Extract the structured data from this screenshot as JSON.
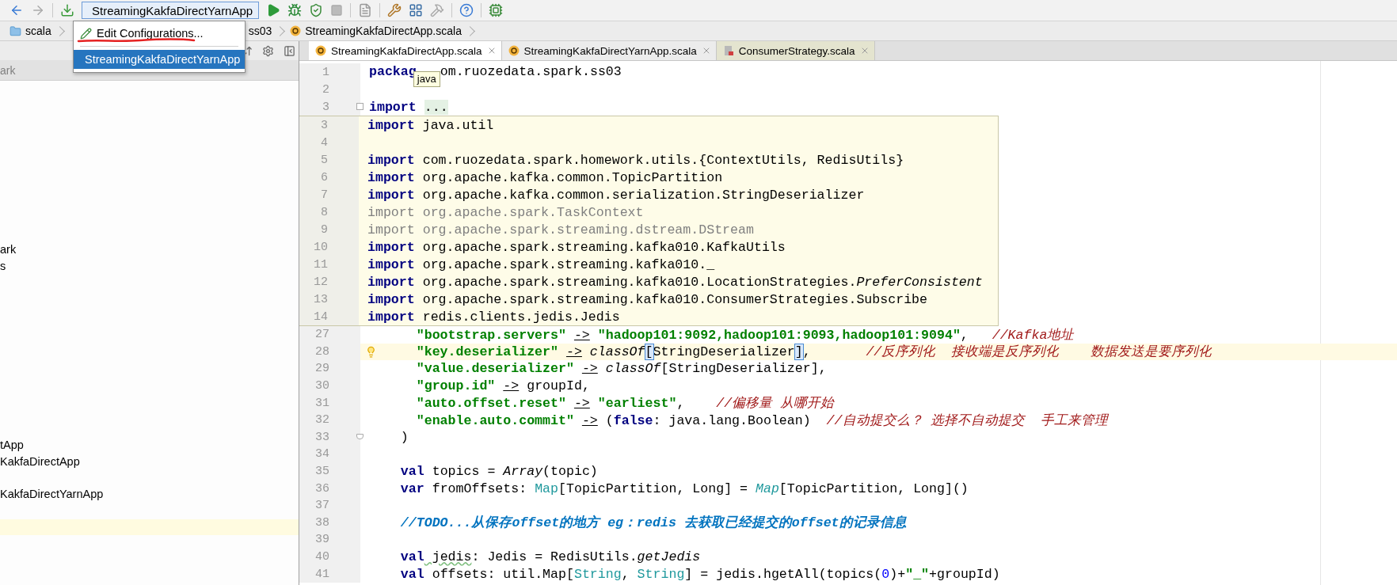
{
  "toolbar": {
    "run_config": "StreamingKakfaDirectYarnApp"
  },
  "run_menu": {
    "items": [
      {
        "kind": "edit",
        "label": "Edit Configurations...",
        "selected": false
      },
      {
        "kind": "config",
        "label": "StreamingKakfaDirectYarnApp",
        "selected": true
      }
    ]
  },
  "breadcrumbs": [
    {
      "kind": "folder",
      "label": "scala"
    },
    {
      "kind": "package",
      "label": "ss03"
    },
    {
      "kind": "object",
      "label": "StreamingKakfaDirectApp.scala"
    }
  ],
  "project_panel": {
    "header": "ark",
    "items": [
      {
        "label": "ark"
      },
      {
        "label": "s"
      },
      {
        "label": "tApp"
      },
      {
        "label": "KakfaDirectApp"
      },
      {
        "label": "KakfaDirectYarnApp"
      }
    ]
  },
  "tabs": [
    {
      "kind": "object",
      "label": "StreamingKakfaDirectApp.scala",
      "selected": true
    },
    {
      "kind": "object",
      "label": "StreamingKakfaDirectYarnApp.scala",
      "selected": false
    },
    {
      "kind": "class",
      "label": "ConsumerStrategy.scala",
      "selected": false
    }
  ],
  "editor": {
    "tooltip": "java",
    "top_lines": [
      {
        "number": "1",
        "folded": false,
        "tokens": [
          {
            "kind": "kw",
            "text": "packag"
          }
        ],
        "after_tooltip": "om.ruozedata.spark.ss03"
      },
      {
        "number": "2",
        "folded": false
      },
      {
        "number": "3",
        "folded": true,
        "tokens": [
          {
            "kind": "kw",
            "text": "import "
          },
          {
            "kind": "fold",
            "text": "..."
          }
        ]
      }
    ],
    "preview_lines": [
      {
        "number": "3",
        "tokens": [
          {
            "kind": "kw",
            "text": "import"
          },
          {
            "kind": "plain",
            "text": " java.util"
          }
        ]
      },
      {
        "number": "4"
      },
      {
        "number": "5",
        "tokens": [
          {
            "kind": "kw",
            "text": "import"
          },
          {
            "kind": "plain",
            "text": " com.ruozedata.spark.homework.utils.{ContextUtils, RedisUtils}"
          }
        ]
      },
      {
        "number": "6",
        "tokens": [
          {
            "kind": "kw",
            "text": "import"
          },
          {
            "kind": "plain",
            "text": " org.apache.kafka.common.TopicPartition"
          }
        ]
      },
      {
        "number": "7",
        "tokens": [
          {
            "kind": "kw",
            "text": "import"
          },
          {
            "kind": "plain",
            "text": " org.apache.kafka.common.serialization.StringDeserializer"
          }
        ]
      },
      {
        "number": "8",
        "tokens": [
          {
            "kind": "dim",
            "text": "import org.apache.spark.TaskContext"
          }
        ]
      },
      {
        "number": "9",
        "tokens": [
          {
            "kind": "dim",
            "text": "import org.apache.spark.streaming.dstream.DStream"
          }
        ]
      },
      {
        "number": "10",
        "tokens": [
          {
            "kind": "kw",
            "text": "import"
          },
          {
            "kind": "plain",
            "text": " org.apache.spark.streaming.kafka010.KafkaUtils"
          }
        ]
      },
      {
        "number": "11",
        "tokens": [
          {
            "kind": "kw",
            "text": "import"
          },
          {
            "kind": "plain",
            "text": " org.apache.spark.streaming.kafka010._"
          }
        ]
      },
      {
        "number": "12",
        "tokens": [
          {
            "kind": "kw",
            "text": "import"
          },
          {
            "kind": "plain",
            "text": " org.apache.spark.streaming.kafka010.LocationStrategies."
          },
          {
            "kind": "it",
            "text": "PreferConsistent"
          }
        ]
      },
      {
        "number": "13",
        "tokens": [
          {
            "kind": "kw",
            "text": "import"
          },
          {
            "kind": "plain",
            "text": " org.apache.spark.streaming.kafka010.ConsumerStrategies.Subscribe"
          }
        ]
      },
      {
        "number": "14",
        "tokens": [
          {
            "kind": "kw",
            "text": "import"
          },
          {
            "kind": "plain",
            "text": " redis.clients.jedis.Jedis"
          }
        ]
      }
    ],
    "lines": [
      {
        "number": "27",
        "current": false,
        "fold_end": false,
        "tokens": [
          {
            "kind": "str",
            "text": "      \"bootstrap.servers\" "
          },
          {
            "kind": "op",
            "text": "->"
          },
          {
            "kind": "str",
            "text": " \"hadoop101:9092,hadoop101:9093,hadoop101:9094\""
          },
          {
            "kind": "plain",
            "text": ",   "
          },
          {
            "kind": "cmt",
            "text": "//Kafka地址"
          }
        ]
      },
      {
        "number": "28",
        "current": true,
        "fold_end": false,
        "tokens": [
          {
            "kind": "str",
            "text": "      \"key.deserializer\" "
          },
          {
            "kind": "op",
            "text": "->"
          },
          {
            "kind": "it",
            "text": " classOf"
          },
          {
            "kind": "match",
            "text": "["
          },
          {
            "kind": "plain",
            "text": "StringDeserializer"
          },
          {
            "kind": "match",
            "text": "]"
          },
          {
            "kind": "plain",
            "text": ",       "
          },
          {
            "kind": "cmt",
            "text": "//反序列化  接收端是反序列化    数据发送是要序列化"
          }
        ]
      },
      {
        "number": "29",
        "current": false,
        "fold_end": false,
        "tokens": [
          {
            "kind": "str",
            "text": "      \"value.deserializer\" "
          },
          {
            "kind": "op",
            "text": "->"
          },
          {
            "kind": "it",
            "text": " classOf"
          },
          {
            "kind": "plain",
            "text": "[StringDeserializer],"
          }
        ]
      },
      {
        "number": "30",
        "current": false,
        "fold_end": false,
        "tokens": [
          {
            "kind": "str",
            "text": "      \"group.id\" "
          },
          {
            "kind": "op",
            "text": "->"
          },
          {
            "kind": "plain",
            "text": " groupId,"
          }
        ]
      },
      {
        "number": "31",
        "current": false,
        "fold_end": false,
        "tokens": [
          {
            "kind": "str",
            "text": "      \"auto.offset.reset\" "
          },
          {
            "kind": "op",
            "text": "->"
          },
          {
            "kind": "str",
            "text": " \"earliest\""
          },
          {
            "kind": "plain",
            "text": ",    "
          },
          {
            "kind": "cmt",
            "text": "//偏移量 从哪开始"
          }
        ]
      },
      {
        "number": "32",
        "current": false,
        "fold_end": false,
        "tokens": [
          {
            "kind": "str",
            "text": "      \"enable.auto.commit\" "
          },
          {
            "kind": "op",
            "text": "->"
          },
          {
            "kind": "plain",
            "text": " ("
          },
          {
            "kind": "kw",
            "text": "false"
          },
          {
            "kind": "plain",
            "text": ": java.lang.Boolean)  "
          },
          {
            "kind": "cmt",
            "text": "//自动提交么？ 选择不自动提交  手工来管理"
          }
        ]
      },
      {
        "number": "33",
        "current": false,
        "fold_end": true,
        "tokens": [
          {
            "kind": "plain",
            "text": "    )"
          }
        ]
      },
      {
        "number": "34",
        "current": false,
        "fold_end": false
      },
      {
        "number": "35",
        "current": false,
        "fold_end": false,
        "tokens": [
          {
            "kind": "kw",
            "text": "    val"
          },
          {
            "kind": "plain",
            "text": " topics = "
          },
          {
            "kind": "it",
            "text": "Array"
          },
          {
            "kind": "plain",
            "text": "(topic)"
          }
        ]
      },
      {
        "number": "36",
        "current": false,
        "fold_end": false,
        "tokens": [
          {
            "kind": "kw",
            "text": "    var"
          },
          {
            "kind": "plain",
            "text": " fromOffsets: "
          },
          {
            "kind": "type",
            "text": "Map"
          },
          {
            "kind": "plain",
            "text": "[TopicPartition, Long] = "
          },
          {
            "kind": "typeit",
            "text": "Map"
          },
          {
            "kind": "plain",
            "text": "[TopicPartition, Long]()"
          }
        ]
      },
      {
        "number": "37",
        "current": false,
        "fold_end": false
      },
      {
        "number": "38",
        "current": false,
        "fold_end": false,
        "tokens": [
          {
            "kind": "todo",
            "text": "    //TODO...从保存offset的地方 eg：redis 去获取已经提交的offset的记录信息"
          }
        ]
      },
      {
        "number": "39",
        "current": false,
        "fold_end": false
      },
      {
        "number": "40",
        "current": false,
        "fold_end": false,
        "tokens": [
          {
            "kind": "kw",
            "text": "    val"
          },
          {
            "kind": "typo",
            "text": " jedis"
          },
          {
            "kind": "plain",
            "text": ": Jedis = RedisUtils."
          },
          {
            "kind": "it",
            "text": "getJedis"
          }
        ]
      },
      {
        "number": "41",
        "current": false,
        "fold_end": false,
        "tokens": [
          {
            "kind": "kw",
            "text": "    val"
          },
          {
            "kind": "plain",
            "text": " offsets: util.Map["
          },
          {
            "kind": "type",
            "text": "String"
          },
          {
            "kind": "plain",
            "text": ", "
          },
          {
            "kind": "type",
            "text": "String"
          },
          {
            "kind": "plain",
            "text": "] = jedis.hgetAll(topics("
          },
          {
            "kind": "num",
            "text": "0"
          },
          {
            "kind": "plain",
            "text": ")+"
          },
          {
            "kind": "str",
            "text": "\"_\""
          },
          {
            "kind": "plain",
            "text": "+groupId)"
          }
        ]
      }
    ]
  }
}
